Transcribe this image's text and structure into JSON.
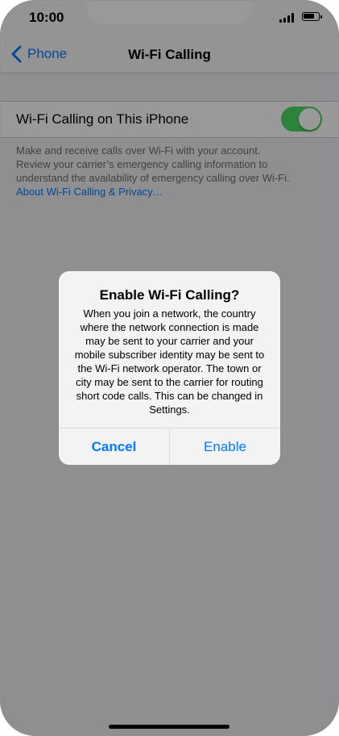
{
  "status_bar": {
    "time": "10:00",
    "battery_level": 0.8
  },
  "nav": {
    "back_label": "Phone",
    "title": "Wi-Fi Calling"
  },
  "settings": {
    "toggle_label": "Wi-Fi Calling on This iPhone",
    "toggle_on": true,
    "footer_lines": [
      "Make and receive calls over Wi-Fi with your        account.",
      "Review your carrier’s emergency calling information to",
      "understand the availability of emergency calling over Wi-Fi."
    ],
    "footer_link": "About Wi-Fi Calling & Privacy…"
  },
  "alert": {
    "title": "Enable Wi-Fi Calling?",
    "message": "When you join a network, the country where the network connection is made may be sent to your carrier and your mobile subscriber identity may be sent to the Wi-Fi network operator. The town or city may be sent to the carrier for routing short code calls. This can be changed in Settings.",
    "cancel_label": "Cancel",
    "enable_label": "Enable"
  },
  "colors": {
    "accent": "#007aff",
    "toggle_on": "#4cd964"
  },
  "icons": [
    "signal-icon",
    "wifi-icon",
    "battery-icon",
    "chevron-left-icon"
  ]
}
